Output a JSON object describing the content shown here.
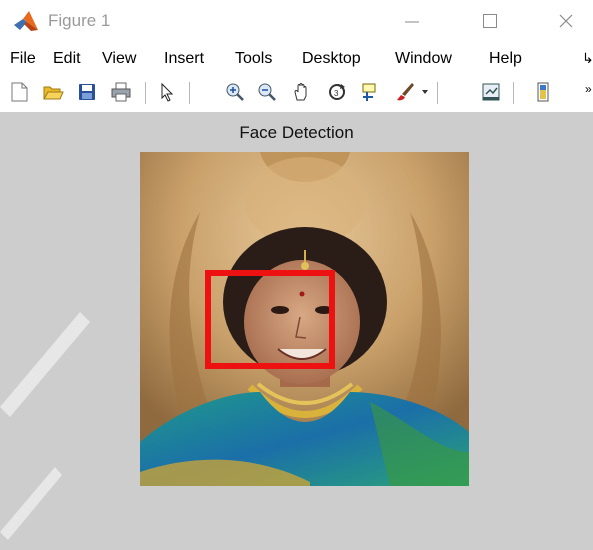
{
  "window": {
    "title": "Figure 1"
  },
  "menu": [
    "File",
    "Edit",
    "View",
    "Insert",
    "Tools",
    "Desktop",
    "Window",
    "Help"
  ],
  "toolbar": {
    "icons": [
      "new-figure-icon",
      "open-file-icon",
      "save-icon",
      "print-icon",
      "pointer-icon",
      "zoom-in-icon",
      "zoom-out-icon",
      "pan-icon",
      "rotate-3d-icon",
      "data-cursor-icon",
      "brush-icon",
      "link-plot-icon",
      "colorbar-icon"
    ]
  },
  "axes": {
    "title": "Face Detection"
  },
  "colors": {
    "canvas": "#cdcdcd",
    "bbox": "#ee1111"
  }
}
